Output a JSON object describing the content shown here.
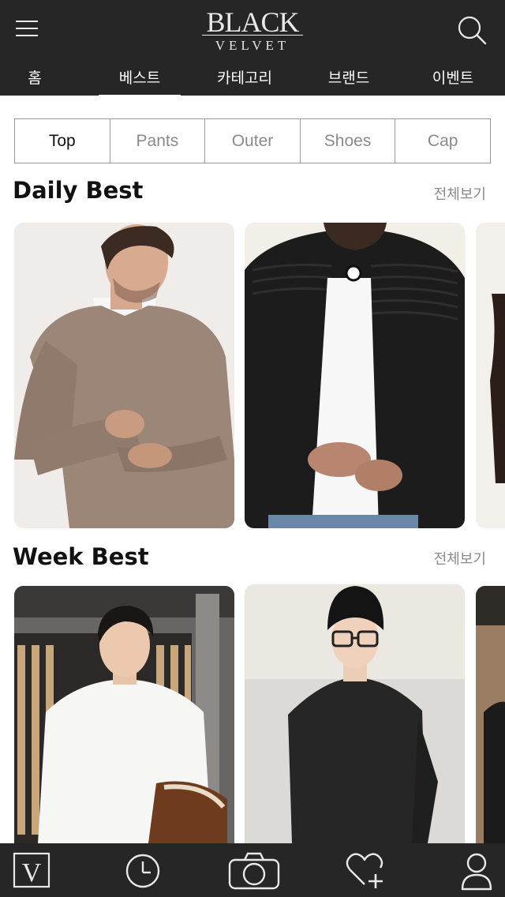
{
  "header": {
    "logo_top": "BLACK",
    "logo_bottom": "VELVET"
  },
  "nav": {
    "items": [
      "홈",
      "베스트",
      "카테고리",
      "브랜드",
      "이벤트"
    ],
    "active": "베스트"
  },
  "category_tabs": [
    "Top",
    "Pants",
    "Outer",
    "Shoes",
    "Cap"
  ],
  "sections": {
    "daily": {
      "title": "Daily Best",
      "see_all": "전체보기"
    },
    "week": {
      "title": "Week Best",
      "see_all": "전체보기"
    }
  },
  "bottom_bar": {
    "logo_letter": "V",
    "icons": [
      "v-logo-icon",
      "clock-icon",
      "camera-icon",
      "heart-plus-icon",
      "profile-icon"
    ]
  },
  "colors": {
    "header_bg": "#262626",
    "header_text": "#ffffff",
    "tab_border": "#9a9a9a",
    "muted_text": "#8a8a8a"
  }
}
